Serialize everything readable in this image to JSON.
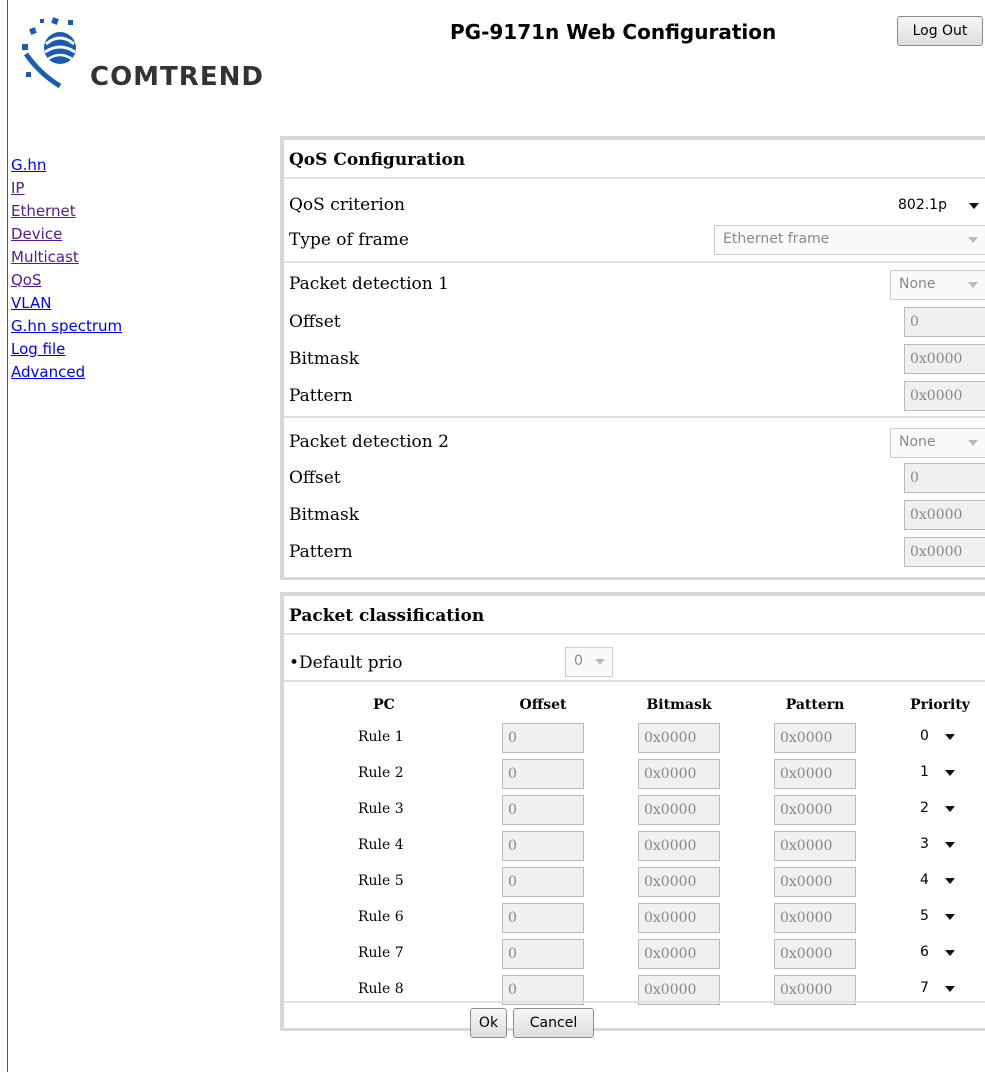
{
  "header": {
    "brand": "COMTREND",
    "title": "PG-9171n Web Configuration",
    "logout_label": "Log Out"
  },
  "nav": {
    "items": [
      "G.hn",
      "IP",
      "Ethernet",
      "Device",
      "Multicast",
      "QoS",
      "VLAN",
      "G.hn spectrum",
      "Log file",
      "Advanced"
    ]
  },
  "qos": {
    "title": "QoS Configuration",
    "criterion_label": "QoS criterion",
    "criterion_value": "802.1p",
    "frame_label": "Type of frame",
    "frame_value": "Ethernet frame",
    "detection1": {
      "label": "Packet detection 1",
      "mode": "None",
      "offset_label": "Offset",
      "offset": "0",
      "bitmask_label": "Bitmask",
      "bitmask": "0x0000",
      "pattern_label": "Pattern",
      "pattern": "0x0000"
    },
    "detection2": {
      "label": "Packet detection 2",
      "mode": "None",
      "offset_label": "Offset",
      "offset": "0",
      "bitmask_label": "Bitmask",
      "bitmask": "0x0000",
      "pattern_label": "Pattern",
      "pattern": "0x0000"
    }
  },
  "classification": {
    "title": "Packet classification",
    "default_prio_label": "•Default prio",
    "default_prio_value": "0",
    "columns": [
      "PC",
      "Offset",
      "Bitmask",
      "Pattern",
      "Priority"
    ],
    "rules": [
      {
        "name": "Rule 1",
        "offset": "0",
        "bitmask": "0x0000",
        "pattern": "0x0000",
        "priority": "0"
      },
      {
        "name": "Rule 2",
        "offset": "0",
        "bitmask": "0x0000",
        "pattern": "0x0000",
        "priority": "1"
      },
      {
        "name": "Rule 3",
        "offset": "0",
        "bitmask": "0x0000",
        "pattern": "0x0000",
        "priority": "2"
      },
      {
        "name": "Rule 4",
        "offset": "0",
        "bitmask": "0x0000",
        "pattern": "0x0000",
        "priority": "3"
      },
      {
        "name": "Rule 5",
        "offset": "0",
        "bitmask": "0x0000",
        "pattern": "0x0000",
        "priority": "4"
      },
      {
        "name": "Rule 6",
        "offset": "0",
        "bitmask": "0x0000",
        "pattern": "0x0000",
        "priority": "5"
      },
      {
        "name": "Rule 7",
        "offset": "0",
        "bitmask": "0x0000",
        "pattern": "0x0000",
        "priority": "6"
      },
      {
        "name": "Rule 8",
        "offset": "0",
        "bitmask": "0x0000",
        "pattern": "0x0000",
        "priority": "7"
      }
    ],
    "ok_label": "Ok",
    "cancel_label": "Cancel"
  }
}
